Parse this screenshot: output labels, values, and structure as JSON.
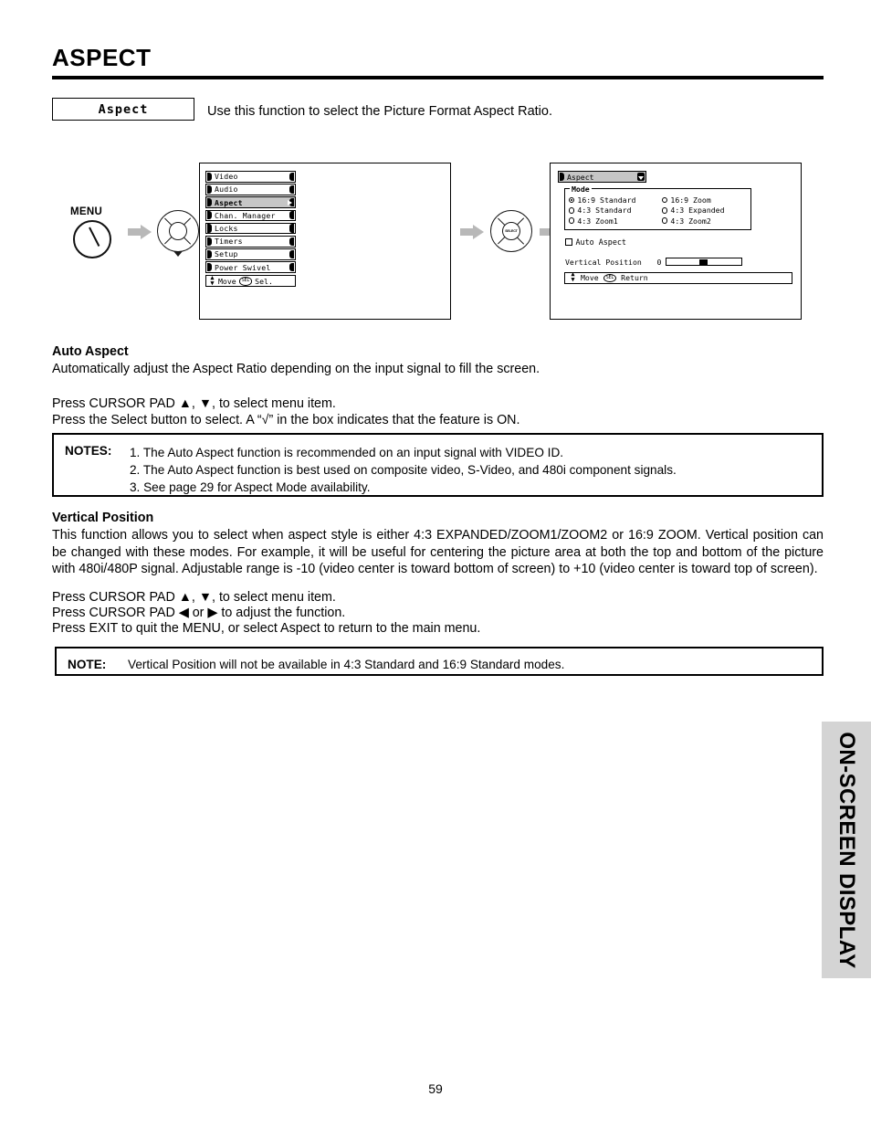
{
  "page": {
    "title": "ASPECT",
    "number": "59",
    "side_tab": "ON-SCREEN DISPLAY"
  },
  "header": {
    "label_box": "Aspect",
    "intro": "Use this function to select the Picture Format Aspect Ratio."
  },
  "osd_main_menu": {
    "items": [
      {
        "label": "Video"
      },
      {
        "label": "Audio"
      },
      {
        "label": "Aspect"
      },
      {
        "label": "Chan. Manager"
      },
      {
        "label": "Locks"
      },
      {
        "label": "Timers"
      },
      {
        "label": "Setup"
      },
      {
        "label": "Power Swivel"
      }
    ],
    "selected_index": 2,
    "footer": {
      "move": "Move",
      "badge": "SEL",
      "action": "Sel."
    }
  },
  "osd_aspect_panel": {
    "title": "Aspect",
    "mode_group_legend": "Mode",
    "mode_options": [
      {
        "label": "16:9 Standard",
        "selected": true
      },
      {
        "label": "16:9 Zoom",
        "selected": false
      },
      {
        "label": "4:3 Standard",
        "selected": false
      },
      {
        "label": "4:3 Expanded",
        "selected": false
      },
      {
        "label": "4:3 Zoom1",
        "selected": false
      },
      {
        "label": "4:3 Zoom2",
        "selected": false
      }
    ],
    "auto_aspect": {
      "label": "Auto Aspect",
      "checked": false
    },
    "vertical_position": {
      "label": "Vertical Position",
      "value": "0"
    },
    "footer": {
      "move": "Move",
      "badge": "SEL",
      "action": "Return"
    }
  },
  "controls": {
    "menu_button_label": "MENU",
    "select_pad_label": "SELECT"
  },
  "auto_aspect_section": {
    "heading": "Auto Aspect",
    "description": "Automatically adjust the Aspect Ratio depending on the input signal to fill the screen.",
    "instruction_1": "Press CURSOR PAD  ▲, ▼, to select menu item.",
    "instruction_2": "Press the Select button  to select.  A “√” in the box indicates that the feature is ON."
  },
  "notes_box": {
    "label": "NOTES:",
    "items": [
      "1. The Auto Aspect function is recommended on an input signal with VIDEO ID.",
      "2. The Auto Aspect function is best used on composite video, S-Video, and 480i component signals.",
      "3. See page 29 for Aspect Mode availability."
    ]
  },
  "vertical_position_section": {
    "heading": "Vertical Position",
    "description": "This function allows you to select when aspect style is either 4:3 EXPANDED/ZOOM1/ZOOM2 or 16:9 ZOOM.  Vertical position can be changed with these modes.  For example, it will be useful for centering the picture area at both the top and bottom of the picture with 480i/480P signal.  Adjustable range is -10 (video center is toward bottom of screen) to +10 (video center is toward top of screen).",
    "instruction_1": "Press CURSOR PAD  ▲, ▼, to select menu item.",
    "instruction_2": "Press CURSOR PAD  ◀ or ▶ to adjust the function.",
    "instruction_3": "Press EXIT to quit the MENU, or select Aspect to return to the main menu."
  },
  "note_box": {
    "label": "NOTE:",
    "text": "Vertical Position will not be available in 4:3 Standard and 16:9 Standard modes."
  }
}
